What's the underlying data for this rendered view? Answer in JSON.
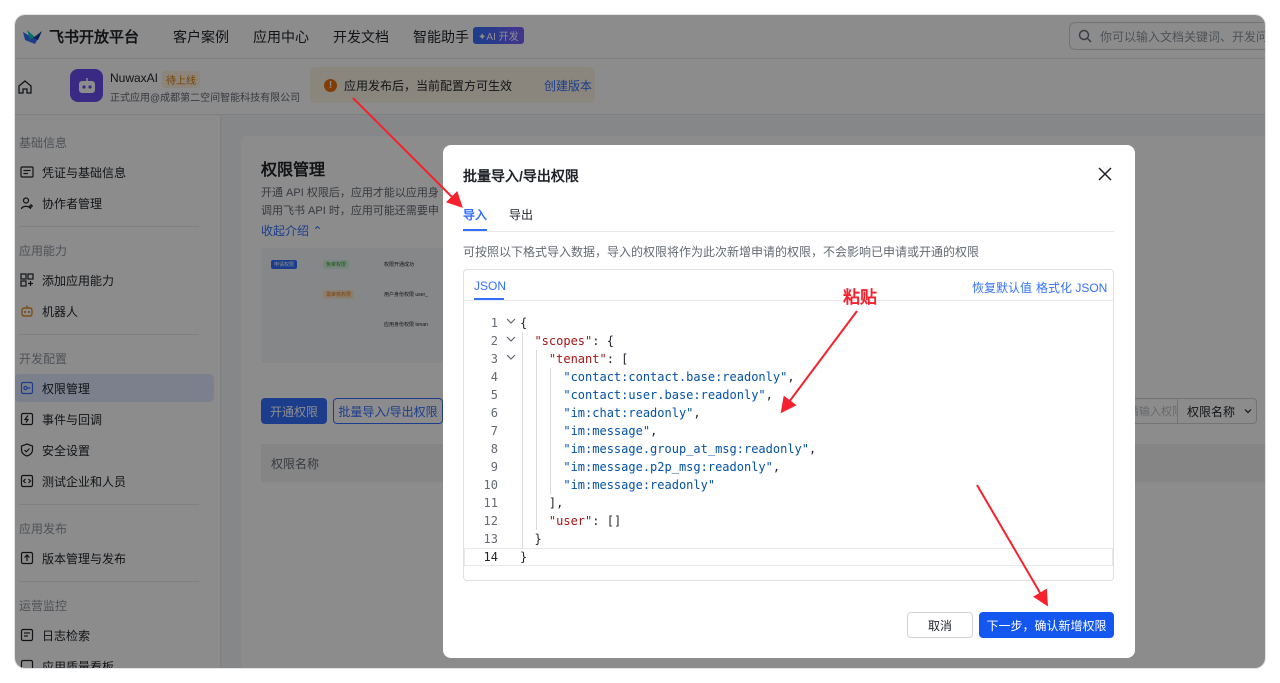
{
  "topnav": {
    "brand": "飞书开放平台",
    "items": [
      "客户案例",
      "应用中心",
      "开发文档",
      "智能助手"
    ],
    "ai_badge": "✦AI 开发",
    "search_placeholder": "你可以输入文档关键词、开发问题"
  },
  "app": {
    "name": "NuwaxAI",
    "status": "待上线",
    "subtitle": "正式应用@成都第二空间智能科技有限公司",
    "notice": "应用发布后，当前配置方可生效",
    "notice_link": "创建版本"
  },
  "sidebar": {
    "sections": [
      {
        "title": "基础信息",
        "items": [
          {
            "label": "凭证与基础信息",
            "icon": "id-card-icon"
          },
          {
            "label": "协作者管理",
            "icon": "user-add-icon"
          }
        ]
      },
      {
        "title": "应用能力",
        "items": [
          {
            "label": "添加应用能力",
            "icon": "grid-plus-icon"
          },
          {
            "label": "机器人",
            "icon": "robot-icon"
          }
        ]
      },
      {
        "title": "开发配置",
        "items": [
          {
            "label": "权限管理",
            "icon": "key-icon",
            "active": true
          },
          {
            "label": "事件与回调",
            "icon": "event-icon"
          },
          {
            "label": "安全设置",
            "icon": "shield-icon"
          },
          {
            "label": "测试企业和人员",
            "icon": "code-icon"
          }
        ]
      },
      {
        "title": "应用发布",
        "items": [
          {
            "label": "版本管理与发布",
            "icon": "upload-icon"
          }
        ]
      },
      {
        "title": "运营监控",
        "items": [
          {
            "label": "日志检索",
            "icon": "log-icon"
          },
          {
            "label": "应用质量看板",
            "icon": "chart-icon"
          }
        ]
      }
    ]
  },
  "main": {
    "title": "权限管理",
    "desc_line1": "开通 API 权限后，应用才能以应用身",
    "desc_line2": "调用飞书 API 时，应用可能还需要申",
    "collapse": "收起介绍",
    "diagram": {
      "n1": "申请权限",
      "n2": "免审权限",
      "n3": "权限开通成功",
      "n4": "需审核权限",
      "n5": "用户身份权限 user_",
      "n6": "应用身份权限 tenan"
    },
    "btn_open": "开通权限",
    "btn_batch": "批量导入/导出权限",
    "filter_placeholder": "请输入权限名称",
    "filter_select": "权限名称",
    "table_col": "权限名称"
  },
  "modal": {
    "title": "批量导入/导出权限",
    "tabs": [
      "导入",
      "导出"
    ],
    "desc": "可按照以下格式导入数据，导入的权限将作为此次新增申请的权限，不会影响已申请或开通的权限",
    "editor_tab": "JSON",
    "restore": "恢复默认值",
    "format": "格式化 JSON",
    "code": {
      "l1": "{",
      "k_scopes": "\"scopes\"",
      "k_tenant": "\"tenant\"",
      "s1": "\"contact:contact.base:readonly\"",
      "s2": "\"contact:user.base:readonly\"",
      "s3": "\"im:chat:readonly\"",
      "s4": "\"im:message\"",
      "s5": "\"im:message.group_at_msg:readonly\"",
      "s6": "\"im:message.p2p_msg:readonly\"",
      "s7": "\"im:message:readonly\"",
      "l11": "],",
      "k_user": "\"user\"",
      "l13": "}",
      "l14": "}",
      "line_numbers": [
        "1",
        "2",
        "3",
        "4",
        "5",
        "6",
        "7",
        "8",
        "9",
        "10",
        "11",
        "12",
        "13",
        "14"
      ]
    },
    "cancel": "取消",
    "next": "下一步，确认新增权限"
  },
  "annotation": {
    "paste_label": "粘贴",
    "arrow_color": "#f5222d"
  }
}
